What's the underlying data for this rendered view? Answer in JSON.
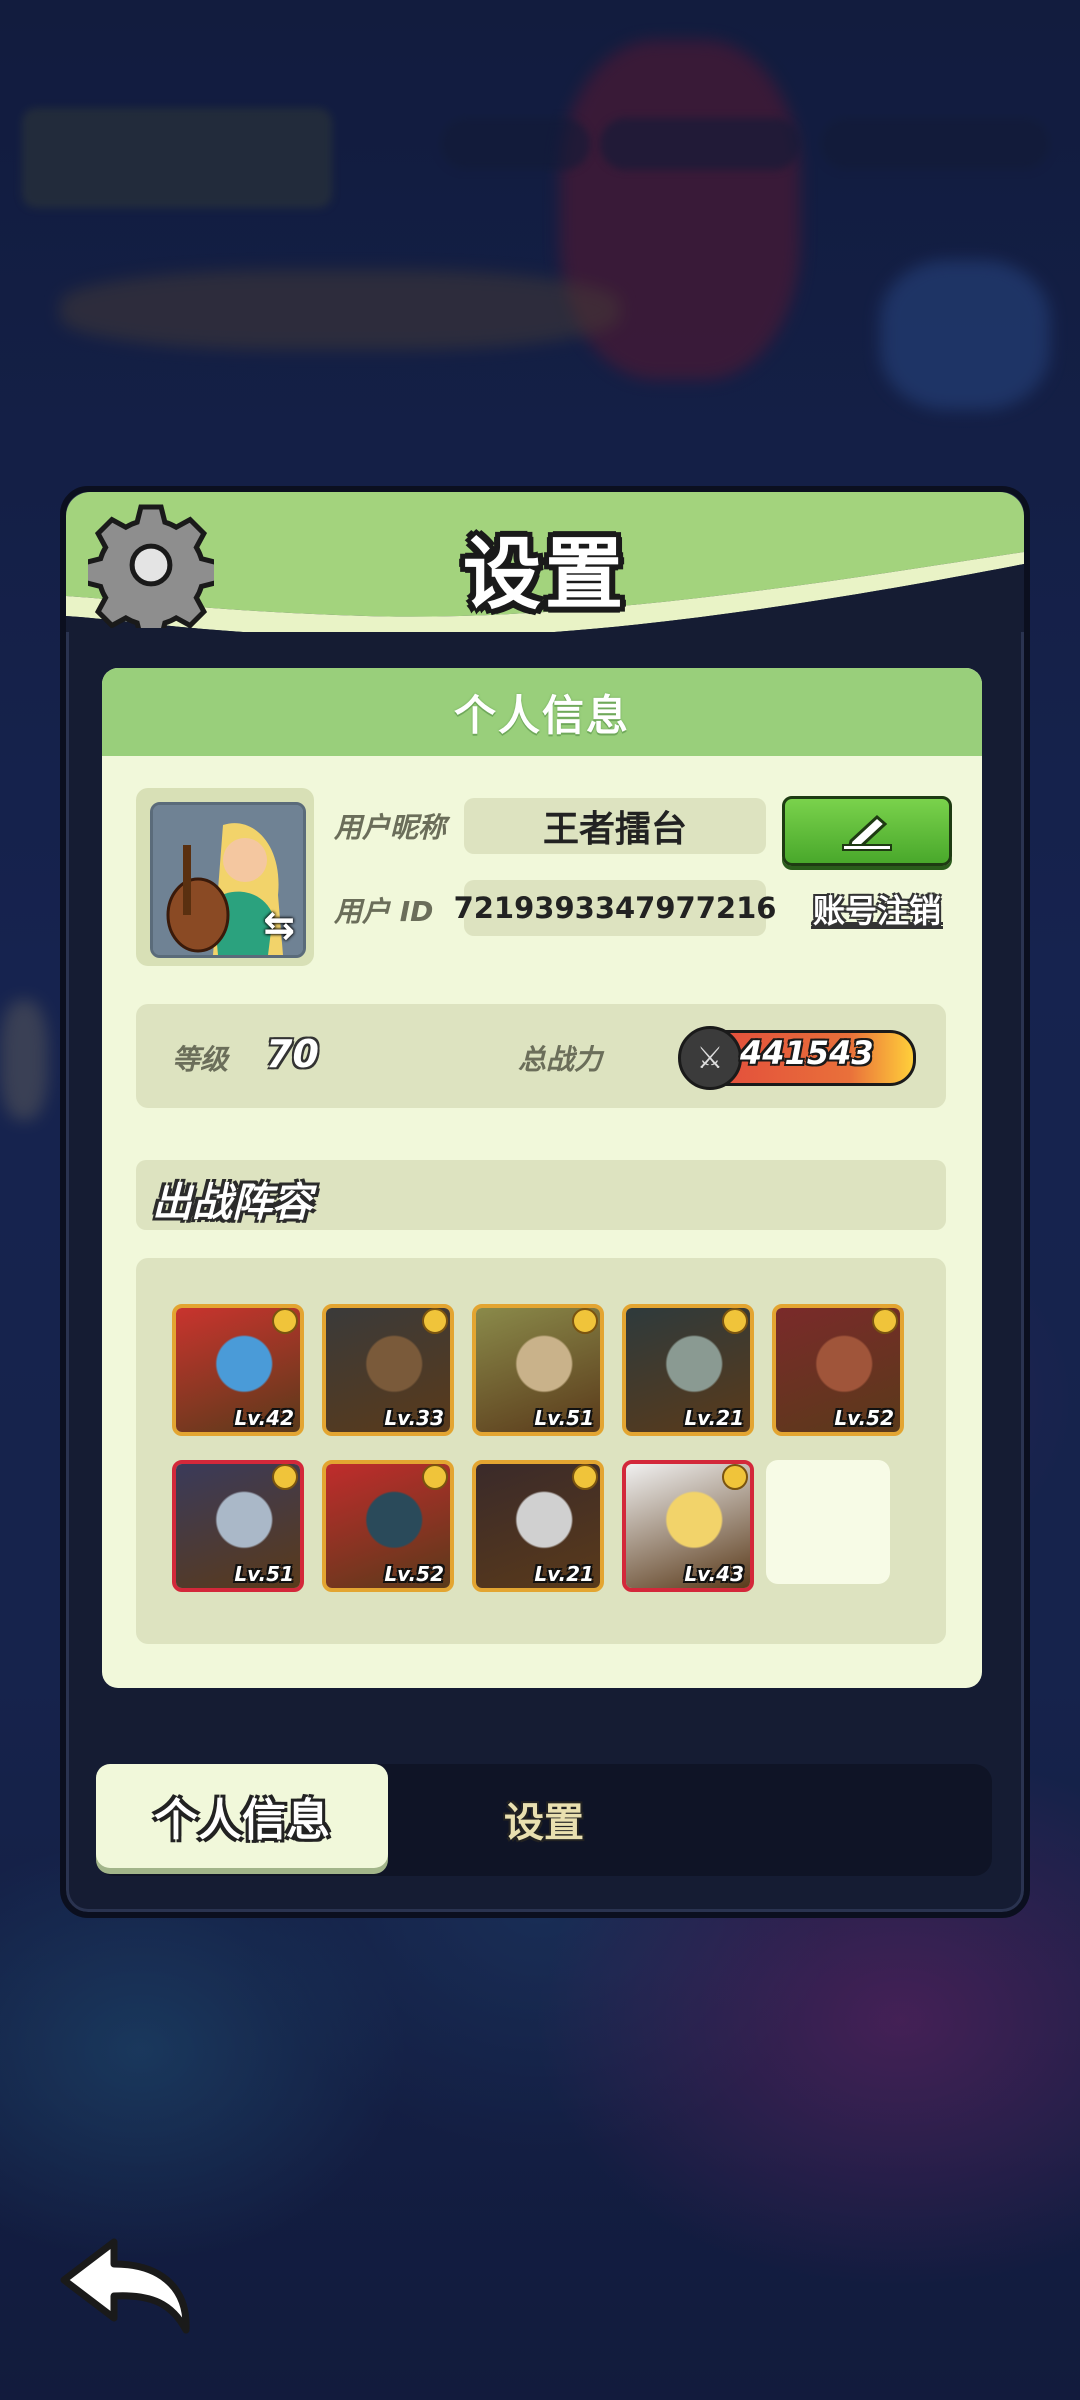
{
  "panel": {
    "title": "设置"
  },
  "profile_card": {
    "header": "个人信息",
    "nickname_label": "用户昵称",
    "nickname_value": "王者擂台",
    "id_label": "用户  ID",
    "id_value": "7219393347977216",
    "cancel_account_link": "账号注销",
    "level_label": "等级",
    "level_value": "70",
    "power_label": "总战力",
    "power_value": "441543"
  },
  "team": {
    "header": "出战阵容",
    "heroes": [
      {
        "level": "Lv.42",
        "frame": "gold",
        "colors": [
          "#c9342e",
          "#4a9bd8"
        ]
      },
      {
        "level": "Lv.33",
        "frame": "gold",
        "colors": [
          "#3a3a3a",
          "#7a5a3a"
        ]
      },
      {
        "level": "Lv.51",
        "frame": "gold",
        "colors": [
          "#8a8a4a",
          "#c9b28a"
        ]
      },
      {
        "level": "Lv.21",
        "frame": "gold",
        "colors": [
          "#2e3a3c",
          "#8a9a92"
        ]
      },
      {
        "level": "Lv.52",
        "frame": "gold",
        "colors": [
          "#7a2a2a",
          "#a0553a"
        ]
      },
      {
        "level": "Lv.51",
        "frame": "red",
        "colors": [
          "#3a3a5a",
          "#aab8c8"
        ]
      },
      {
        "level": "Lv.52",
        "frame": "gold",
        "colors": [
          "#c02c2c",
          "#2a4a5a"
        ]
      },
      {
        "level": "Lv.21",
        "frame": "gold",
        "colors": [
          "#3a2a2a",
          "#d0d0d0"
        ]
      },
      {
        "level": "Lv.43",
        "frame": "red",
        "colors": [
          "#f0f0f0",
          "#f2d36a"
        ]
      }
    ]
  },
  "tabs": [
    {
      "label": "个人信息",
      "active": true
    },
    {
      "label": "设置",
      "active": false
    }
  ],
  "colors": {
    "header_green": "#99cf7b",
    "card_bg": "#f1f8da",
    "edit_button": "#5dbb35",
    "power_bar": "#e24a3c"
  },
  "icons": {
    "gear": "gear-icon",
    "edit": "pencil-icon",
    "swap": "swap-arrows-icon",
    "power": "crossed-swords-icon",
    "back": "back-arrow-icon"
  }
}
